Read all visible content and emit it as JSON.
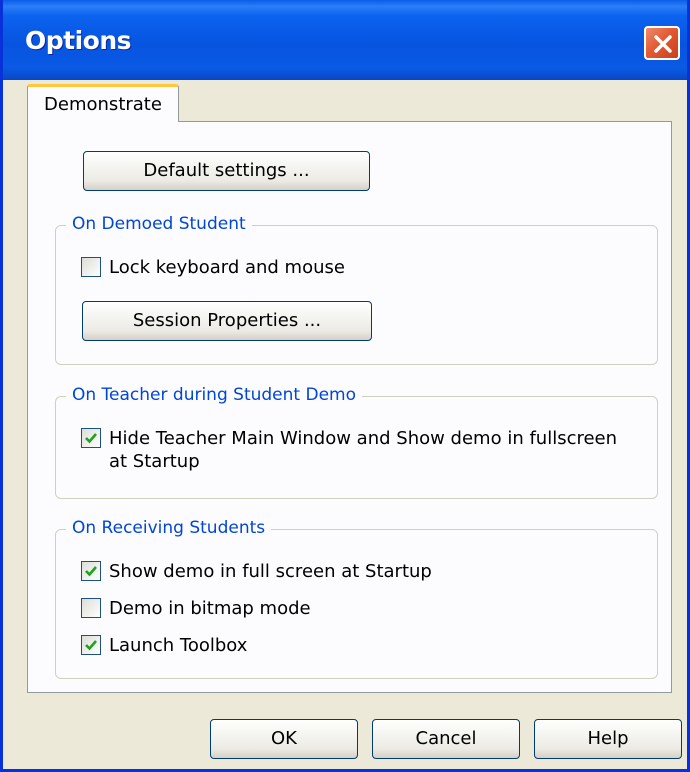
{
  "window": {
    "title": "Options"
  },
  "tabs": [
    {
      "label": "Demonstrate",
      "active": true
    }
  ],
  "default_settings_button": "Default settings ...",
  "groups": {
    "demoed_student": {
      "title": "On Demoed Student",
      "lock_keyboard": {
        "label": "Lock keyboard and mouse",
        "checked": false
      },
      "session_button": "Session Properties ..."
    },
    "teacher": {
      "title": "On Teacher during Student Demo",
      "hide_main": {
        "label_line1": "Hide Teacher Main Window and Show demo in fullscreen",
        "label_line2": "at Startup",
        "checked": true
      }
    },
    "receiving": {
      "title": "On Receiving Students",
      "fullscreen": {
        "label": "Show demo in full screen at Startup",
        "checked": true
      },
      "bitmap": {
        "label": "Demo in bitmap mode",
        "checked": false
      },
      "toolbox": {
        "label": "Launch Toolbox",
        "checked": true
      }
    }
  },
  "footer": {
    "ok": "OK",
    "cancel": "Cancel",
    "help": "Help"
  },
  "colors": {
    "titlebar": "#0754e0",
    "legend": "#0046d5",
    "check": "#21a121",
    "close": "#e25b34"
  }
}
